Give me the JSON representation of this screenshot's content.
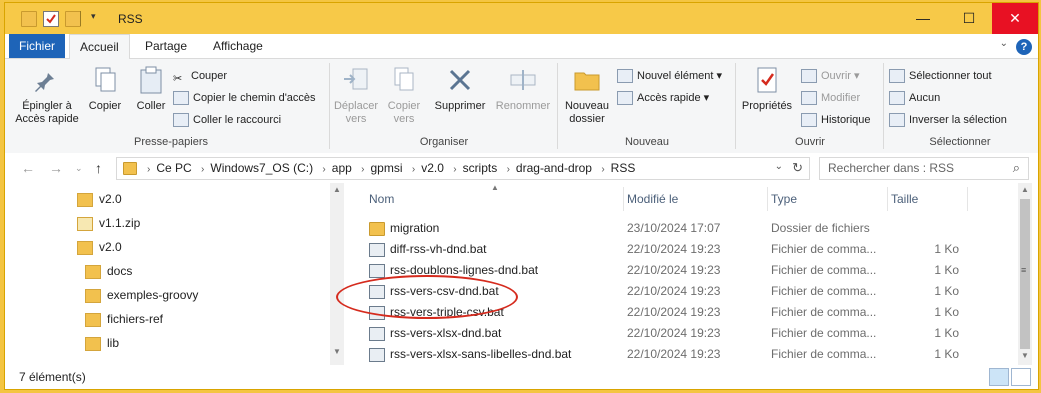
{
  "window": {
    "title": "RSS",
    "buttons": {
      "minimize": "—",
      "maximize": "☐",
      "close": "✕"
    }
  },
  "ribbon_tabs": [
    {
      "label": "Fichier"
    },
    {
      "label": "Accueil"
    },
    {
      "label": "Partage"
    },
    {
      "label": "Affichage"
    }
  ],
  "ribbon": {
    "presse_papiers": {
      "group_label": "Presse-papiers",
      "pin_line1": "Épingler à",
      "pin_line2": "Accès rapide",
      "copy": "Copier",
      "paste": "Coller",
      "cut": "Couper",
      "copy_path": "Copier le chemin d'accès",
      "paste_shortcut": "Coller le raccourci"
    },
    "organiser": {
      "group_label": "Organiser",
      "move_line1": "Déplacer",
      "move_line2": "vers",
      "copyto_line1": "Copier",
      "copyto_line2": "vers",
      "delete": "Supprimer",
      "rename": "Renommer"
    },
    "nouveau": {
      "group_label": "Nouveau",
      "new_folder_line1": "Nouveau",
      "new_folder_line2": "dossier",
      "new_item": "Nouvel élément",
      "quick_access": "Accès rapide"
    },
    "ouvrir": {
      "group_label": "Ouvrir",
      "properties": "Propriétés",
      "open": "Ouvrir",
      "edit": "Modifier",
      "history": "Historique"
    },
    "selection": {
      "group_label": "Sélectionner",
      "select_all": "Sélectionner tout",
      "select_none": "Aucun",
      "invert": "Inverser la sélection"
    }
  },
  "address": {
    "crumbs": [
      "Ce PC",
      "Windows7_OS (C:)",
      "app",
      "gpmsi",
      "v2.0",
      "scripts",
      "drag-and-drop",
      "RSS"
    ],
    "search_placeholder": "Rechercher dans : RSS"
  },
  "tree": [
    {
      "label": "v2.0",
      "indent": 0,
      "icon": "folder-icon"
    },
    {
      "label": "v1.1.zip",
      "indent": 0,
      "icon": "zip-icon"
    },
    {
      "label": "v2.0",
      "indent": 0,
      "icon": "folder-icon"
    },
    {
      "label": "docs",
      "indent": 1,
      "icon": "folder-icon"
    },
    {
      "label": "exemples-groovy",
      "indent": 1,
      "icon": "folder-icon"
    },
    {
      "label": "fichiers-ref",
      "indent": 1,
      "icon": "folder-icon"
    },
    {
      "label": "lib",
      "indent": 1,
      "icon": "folder-icon"
    }
  ],
  "columns": {
    "name": "Nom",
    "modified": "Modifié le",
    "type": "Type",
    "size": "Taille"
  },
  "files": [
    {
      "name": "migration",
      "date": "23/10/2024 17:07",
      "type": "Dossier de fichiers",
      "size": "",
      "icon": "folder-icon"
    },
    {
      "name": "diff-rss-vh-dnd.bat",
      "date": "22/10/2024 19:23",
      "type": "Fichier de comma...",
      "size": "1 Ko",
      "icon": "bat-file-icon"
    },
    {
      "name": "rss-doublons-lignes-dnd.bat",
      "date": "22/10/2024 19:23",
      "type": "Fichier de comma...",
      "size": "1 Ko",
      "icon": "bat-file-icon"
    },
    {
      "name": "rss-vers-csv-dnd.bat",
      "date": "22/10/2024 19:23",
      "type": "Fichier de comma...",
      "size": "1 Ko",
      "icon": "bat-file-icon"
    },
    {
      "name": "rss-vers-triple-csv.bat",
      "date": "22/10/2024 19:23",
      "type": "Fichier de comma...",
      "size": "1 Ko",
      "icon": "bat-file-icon"
    },
    {
      "name": "rss-vers-xlsx-dnd.bat",
      "date": "22/10/2024 19:23",
      "type": "Fichier de comma...",
      "size": "1 Ko",
      "icon": "bat-file-icon"
    },
    {
      "name": "rss-vers-xlsx-sans-libelles-dnd.bat",
      "date": "22/10/2024 19:23",
      "type": "Fichier de comma...",
      "size": "1 Ko",
      "icon": "bat-file-icon"
    }
  ],
  "status": {
    "count": "7 élément(s)"
  },
  "colors": {
    "titlebar": "#f7c948",
    "accent": "#1e64b8",
    "close": "#e81123",
    "highlight_ellipse": "#d52b1e"
  }
}
